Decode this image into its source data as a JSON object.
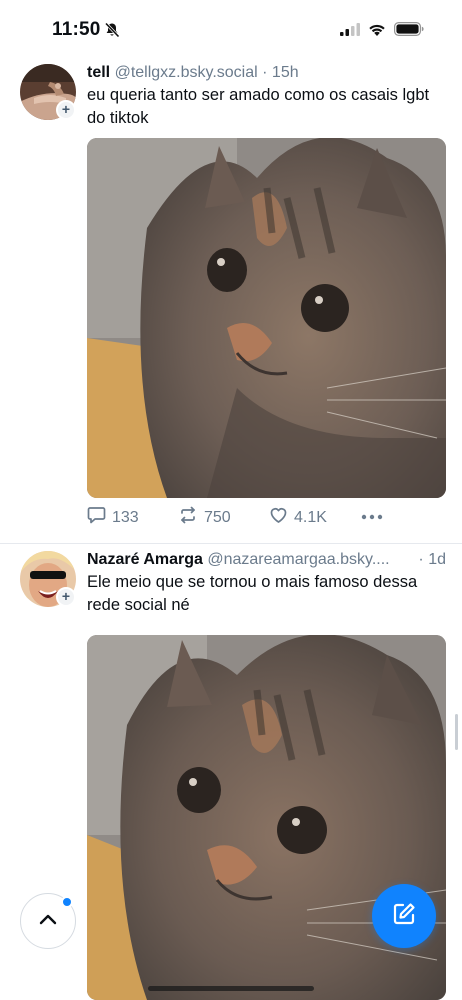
{
  "status_bar": {
    "time": "11:50",
    "icons": [
      "bell-slash-icon",
      "signal-icon",
      "wifi-icon",
      "battery-icon"
    ]
  },
  "posts": [
    {
      "display_name": "tell",
      "handle": "@tellgxz.bsky.social",
      "separator": "·",
      "time": "15h",
      "text": "eu queria tanto ser amado como os casais lgbt do tiktok",
      "replies": "133",
      "reposts": "750",
      "likes": "4.1K",
      "avatar_badge": "+"
    },
    {
      "display_name": "Nazaré Amarga",
      "handle": "@nazareamargaa.bsky....",
      "separator": "·",
      "time": "1d",
      "text": "Ele meio que se tornou o mais famoso dessa rede social né",
      "avatar_badge": "+"
    }
  ],
  "colors": {
    "accent": "#1083fe",
    "muted_text": "#6b7b8c",
    "divider": "#e6e9ee"
  }
}
